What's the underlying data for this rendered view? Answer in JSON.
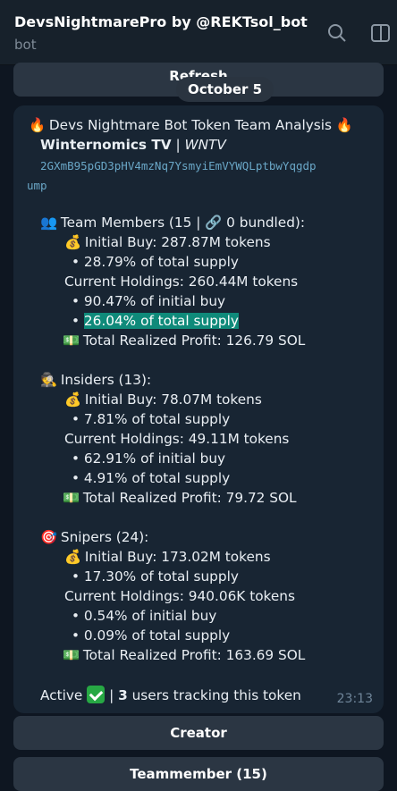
{
  "header": {
    "title": "DevsNightmarePro by @REKTsol_bot",
    "subtitle": "bot"
  },
  "keyboard_top": {
    "refresh": "Refresh"
  },
  "date_separator": "October 5",
  "message": {
    "title": "Devs Nightmare Bot Token Team Analysis",
    "token_name": "Winternomics TV",
    "token_separator": " | ",
    "token_symbol": "WNTV",
    "contract_line1": "2GXmB95pGD3pHV4mzNq7YsmyiEmVYWQLptbwYqgdp",
    "contract_line2": "ump",
    "team": {
      "heading": "Team Members (15 | 🔗 0 bundled):",
      "initial_buy": "Initial Buy: 287.87M tokens",
      "initial_pct": "• 28.79% of total supply",
      "holdings": "Current Holdings: 260.44M tokens",
      "holdings_pct_initial": "• 90.47% of initial buy",
      "holdings_pct_supply": "26.04% of total supply",
      "profit": "Total Realized Profit: 126.79 SOL"
    },
    "insiders": {
      "heading": "Insiders (13):",
      "initial_buy": "Initial Buy: 78.07M tokens",
      "initial_pct": "• 7.81% of total supply",
      "holdings": "Current Holdings: 49.11M tokens",
      "holdings_pct_initial": "• 62.91% of initial buy",
      "holdings_pct_supply": "• 4.91% of total supply",
      "profit": "Total Realized Profit: 79.72 SOL"
    },
    "snipers": {
      "heading": "Snipers (24):",
      "initial_buy": "Initial Buy: 173.02M tokens",
      "initial_pct": "• 17.30% of total supply",
      "holdings": "Current Holdings: 940.06K tokens",
      "holdings_pct_initial": "• 0.54% of initial buy",
      "holdings_pct_supply": "• 0.09% of total supply",
      "profit": "Total Realized Profit: 163.69 SOL"
    },
    "footer_active": "Active",
    "footer_sep": " | ",
    "footer_count": "3",
    "footer_rest": " users tracking this token",
    "time": "23:13"
  },
  "keyboard": {
    "creator": "Creator",
    "teammember": "Teammember (15)"
  },
  "icons": [
    "fire-icon",
    "team-icon",
    "moneybag-icon",
    "money-icon",
    "detective-icon",
    "target-icon",
    "search-icon",
    "sidebar-icon",
    "check-icon"
  ],
  "colors": {
    "bg": "#0e1621",
    "bubble": "#182533",
    "highlight": "#0f8a7a",
    "link": "#6aa7c7"
  }
}
